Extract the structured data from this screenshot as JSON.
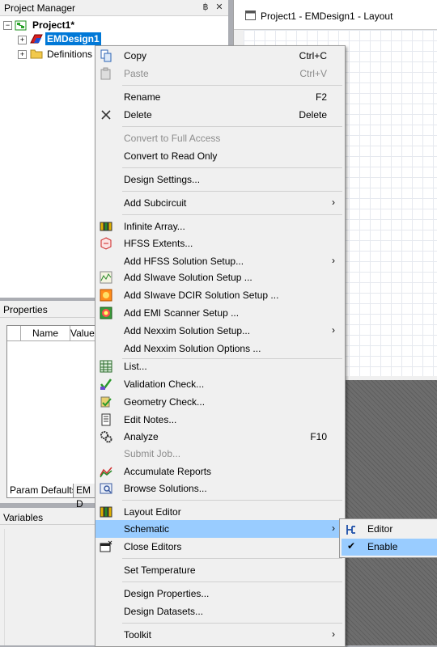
{
  "project_manager": {
    "title": "Project Manager",
    "pin_glyph": "฿",
    "close_glyph": "✕",
    "tree": {
      "project": "Project1*",
      "design": "EMDesign1",
      "definitions": "Definitions"
    }
  },
  "layout_window": {
    "title": "Project1 - EMDesign1 - Layout"
  },
  "properties": {
    "title": "Properties",
    "columns": [
      "Name",
      "Value"
    ],
    "tabs": [
      "Param Defaults",
      "EM D"
    ]
  },
  "variables": {
    "title": "Variables"
  },
  "context_menu": {
    "items": {
      "copy": {
        "label": "Copy",
        "shortcut": "Ctrl+C"
      },
      "paste": {
        "label": "Paste",
        "shortcut": "Ctrl+V"
      },
      "rename": {
        "label": "Rename",
        "shortcut": "F2"
      },
      "delete": {
        "label": "Delete",
        "shortcut": "Delete"
      },
      "convert_full": {
        "label": "Convert to Full Access"
      },
      "convert_read": {
        "label": "Convert to Read Only"
      },
      "design_settings": {
        "label": "Design Settings..."
      },
      "add_subcircuit": {
        "label": "Add Subcircuit"
      },
      "infinite_array": {
        "label": "Infinite Array..."
      },
      "hfss_extents": {
        "label": "HFSS Extents..."
      },
      "add_hfss": {
        "label": "Add HFSS Solution Setup..."
      },
      "add_siwave": {
        "label": "Add SIwave Solution Setup ..."
      },
      "add_siwave_dcir": {
        "label": "Add SIwave DCIR Solution Setup ..."
      },
      "add_emi": {
        "label": "Add EMI Scanner Setup ..."
      },
      "add_nexxim": {
        "label": "Add Nexxim Solution Setup..."
      },
      "add_nexxim_opts": {
        "label": "Add Nexxim Solution Options ..."
      },
      "list": {
        "label": "List..."
      },
      "validation": {
        "label": "Validation Check..."
      },
      "geometry": {
        "label": "Geometry Check..."
      },
      "edit_notes": {
        "label": "Edit Notes..."
      },
      "analyze": {
        "label": "Analyze",
        "shortcut": "F10"
      },
      "submit_job": {
        "label": "Submit Job..."
      },
      "accumulate": {
        "label": "Accumulate Reports"
      },
      "browse": {
        "label": "Browse Solutions..."
      },
      "layout_editor": {
        "label": "Layout Editor"
      },
      "schematic": {
        "label": "Schematic"
      },
      "close_editors": {
        "label": "Close Editors"
      },
      "set_temperature": {
        "label": "Set Temperature"
      },
      "design_properties": {
        "label": "Design Properties..."
      },
      "design_datasets": {
        "label": "Design Datasets..."
      },
      "toolkit": {
        "label": "Toolkit"
      }
    },
    "submenu_arrow": "›"
  },
  "schematic_submenu": {
    "editor": "Editor",
    "enable": "Enable",
    "check_glyph": "✔"
  },
  "colors": {
    "highlight": "#99ccff",
    "selection": "#0078d7",
    "menu_bg": "#f0f0f0",
    "disabled_text": "#8d8d8d"
  }
}
